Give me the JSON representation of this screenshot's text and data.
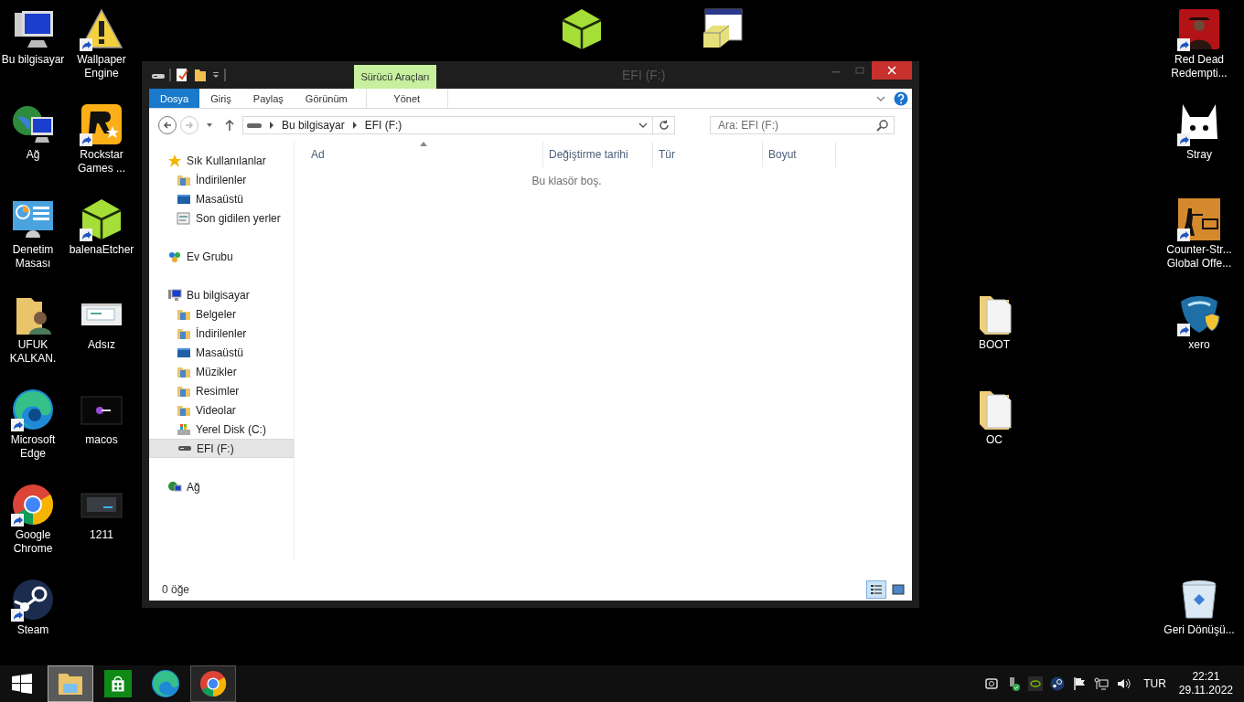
{
  "desktop": {
    "icons": [
      {
        "label": "Bu bilgisayar",
        "kind": "computer",
        "shortcut": false
      },
      {
        "label": "Ağ",
        "kind": "network",
        "shortcut": false
      },
      {
        "label": "Denetim Masası",
        "kind": "control-panel",
        "shortcut": false
      },
      {
        "label": "UFUK KALKAN.",
        "kind": "user-folder",
        "shortcut": false
      },
      {
        "label": "Microsoft Edge",
        "kind": "edge",
        "shortcut": true
      },
      {
        "label": "Google Chrome",
        "kind": "chrome",
        "shortcut": true
      },
      {
        "label": "Steam",
        "kind": "steam",
        "shortcut": true
      },
      {
        "label": "Wallpaper Engine",
        "kind": "warning",
        "shortcut": true
      },
      {
        "label": "Rockstar Games ...",
        "kind": "rockstar",
        "shortcut": true
      },
      {
        "label": "balenaEtcher",
        "kind": "cube",
        "shortcut": true
      },
      {
        "label": "Adsız",
        "kind": "window-thumb",
        "shortcut": false
      },
      {
        "label": "macos",
        "kind": "dark-thumb",
        "shortcut": false
      },
      {
        "label": "1211",
        "kind": "screen-thumb",
        "shortcut": false
      },
      {
        "kind": "cube"
      },
      {
        "kind": "installer"
      },
      {
        "label": "BOOT",
        "kind": "folder",
        "shortcut": false
      },
      {
        "label": "OC",
        "kind": "folder",
        "shortcut": false
      },
      {
        "label": "Red Dead Redempti...",
        "kind": "red-game",
        "shortcut": true
      },
      {
        "label": "Stray",
        "kind": "cat",
        "shortcut": true
      },
      {
        "label": "Counter-Str... Global Offe...",
        "kind": "csgo",
        "shortcut": true
      },
      {
        "label": "xero",
        "kind": "shield",
        "shortcut": true
      },
      {
        "label": "Geri Dönüşü...",
        "kind": "recycle-bin",
        "shortcut": false
      }
    ]
  },
  "window": {
    "title": "EFI (F:)",
    "contextual_group": "Sürücü Araçları",
    "ribbon_tabs": [
      {
        "label": "Dosya",
        "kind": "file"
      },
      {
        "label": "Giriş",
        "kind": "tab"
      },
      {
        "label": "Paylaş",
        "kind": "tab"
      },
      {
        "label": "Görünüm",
        "kind": "tab"
      },
      {
        "label": "Yönet",
        "kind": "contextual"
      }
    ],
    "address": {
      "path": [
        "Bu bilgisayar",
        "EFI (F:)"
      ]
    },
    "search": {
      "placeholder": "Ara: EFI (F:)"
    },
    "nav": [
      {
        "label": "Sık Kullanılanlar",
        "kind": "star",
        "selected": false,
        "children": [
          {
            "label": "İndirilenler",
            "kind": "folder",
            "selected": false
          },
          {
            "label": "Masaüstü",
            "kind": "desktop",
            "selected": false
          },
          {
            "label": "Son gidilen yerler",
            "kind": "recent",
            "selected": false
          }
        ]
      },
      {
        "label": "Ev Grubu",
        "kind": "homegroup",
        "selected": false
      },
      {
        "label": "Bu bilgisayar",
        "kind": "computer",
        "selected": false,
        "children": [
          {
            "label": "Belgeler",
            "kind": "folder",
            "selected": false
          },
          {
            "label": "İndirilenler",
            "kind": "folder",
            "selected": false
          },
          {
            "label": "Masaüstü",
            "kind": "desktop",
            "selected": false
          },
          {
            "label": "Müzikler",
            "kind": "folder",
            "selected": false
          },
          {
            "label": "Resimler",
            "kind": "folder",
            "selected": false
          },
          {
            "label": "Videolar",
            "kind": "folder",
            "selected": false
          },
          {
            "label": "Yerel Disk (C:)",
            "kind": "disk",
            "selected": false
          },
          {
            "label": "EFI (F:)",
            "kind": "drive",
            "selected": true
          }
        ]
      },
      {
        "label": "Ağ",
        "kind": "network",
        "selected": false
      }
    ],
    "columns": [
      "Ad",
      "Değiştirme tarihi",
      "Tür",
      "Boyut"
    ],
    "empty_message": "Bu klasör boş.",
    "status_bar": {
      "item_count": "0 öğe",
      "views": [
        {
          "kind": "details",
          "selected": true
        },
        {
          "kind": "large-icons",
          "selected": false
        }
      ]
    }
  },
  "taskbar": {
    "apps": [
      {
        "kind": "explorer",
        "running": true,
        "active": true
      },
      {
        "kind": "store",
        "running": false,
        "active": false
      },
      {
        "kind": "edge",
        "running": false,
        "active": false
      },
      {
        "kind": "chrome",
        "running": true,
        "active": false
      }
    ],
    "language": "TUR",
    "time": "22:21",
    "date": "29.11.2022"
  }
}
